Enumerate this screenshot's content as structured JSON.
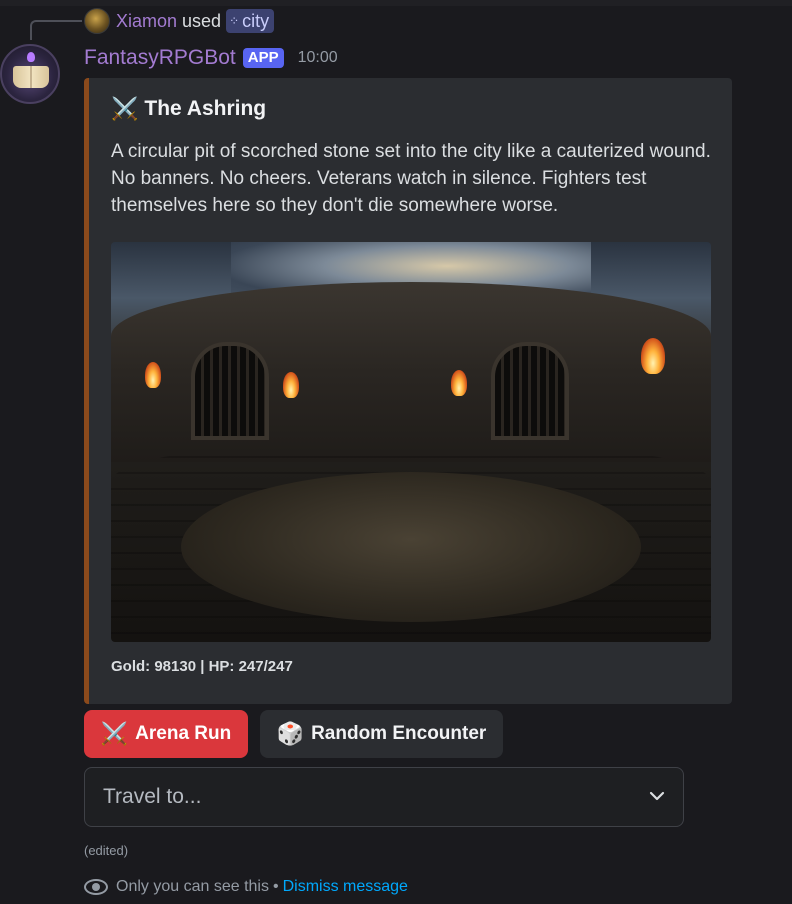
{
  "reply": {
    "user": "Xiamon",
    "used_text": "used",
    "command": "city",
    "command_icon": "slash-command-icon"
  },
  "message": {
    "bot_name": "FantasyRPGBot",
    "badge": "APP",
    "timestamp": "10:00",
    "avatar_icon": "spellbook-avatar-icon"
  },
  "embed": {
    "accent_color": "#8b4a1c",
    "title_emoji": "⚔️",
    "title": "The Ashring",
    "description": "A circular pit of scorched stone set into the city like a cauterized wound. No banners. No cheers. Veterans watch in silence. Fighters test themselves here so they don't die somewhere worse.",
    "image_icon": "arena-image",
    "footer": "Gold: 98130 | HP: 247/247"
  },
  "buttons": [
    {
      "emoji": "⚔️",
      "label": "Arena Run",
      "style_color": "#da373c"
    },
    {
      "emoji": "🎲",
      "label": "Random Encounter",
      "style_color": "#2b2d31"
    }
  ],
  "select": {
    "placeholder": "Travel to...",
    "icon": "chevron-down-icon"
  },
  "edited_label": "(edited)",
  "ephemeral": {
    "text": "Only you can see this",
    "separator": "•",
    "dismiss_label": "Dismiss message"
  }
}
